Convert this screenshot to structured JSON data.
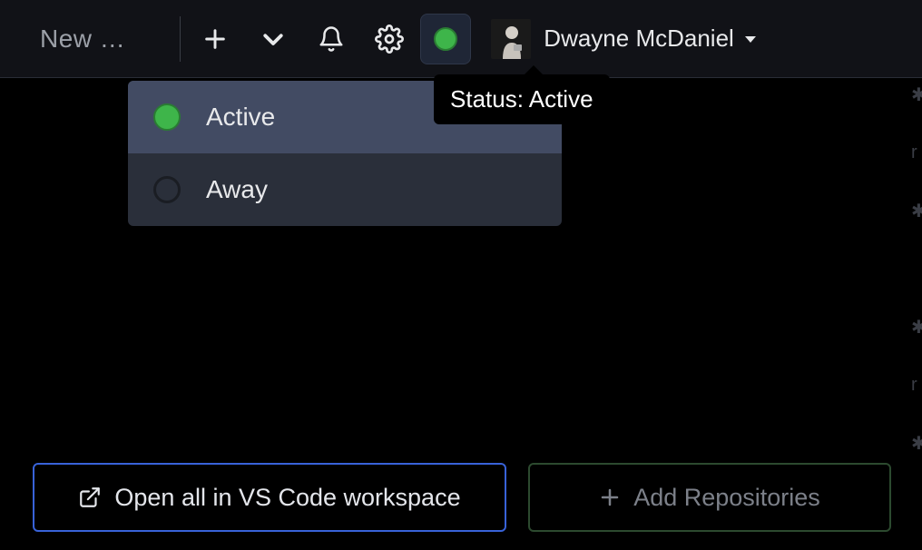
{
  "topbar": {
    "new_label": "New …",
    "username": "Dwayne McDaniel"
  },
  "tooltip": {
    "text": "Status: Active"
  },
  "status_menu": {
    "items": [
      {
        "label": "Active",
        "state": "active",
        "selected": true
      },
      {
        "label": "Away",
        "state": "away",
        "selected": false
      }
    ]
  },
  "buttons": {
    "open_workspace": "Open all in VS Code workspace",
    "add_repos": "Add Repositories"
  }
}
